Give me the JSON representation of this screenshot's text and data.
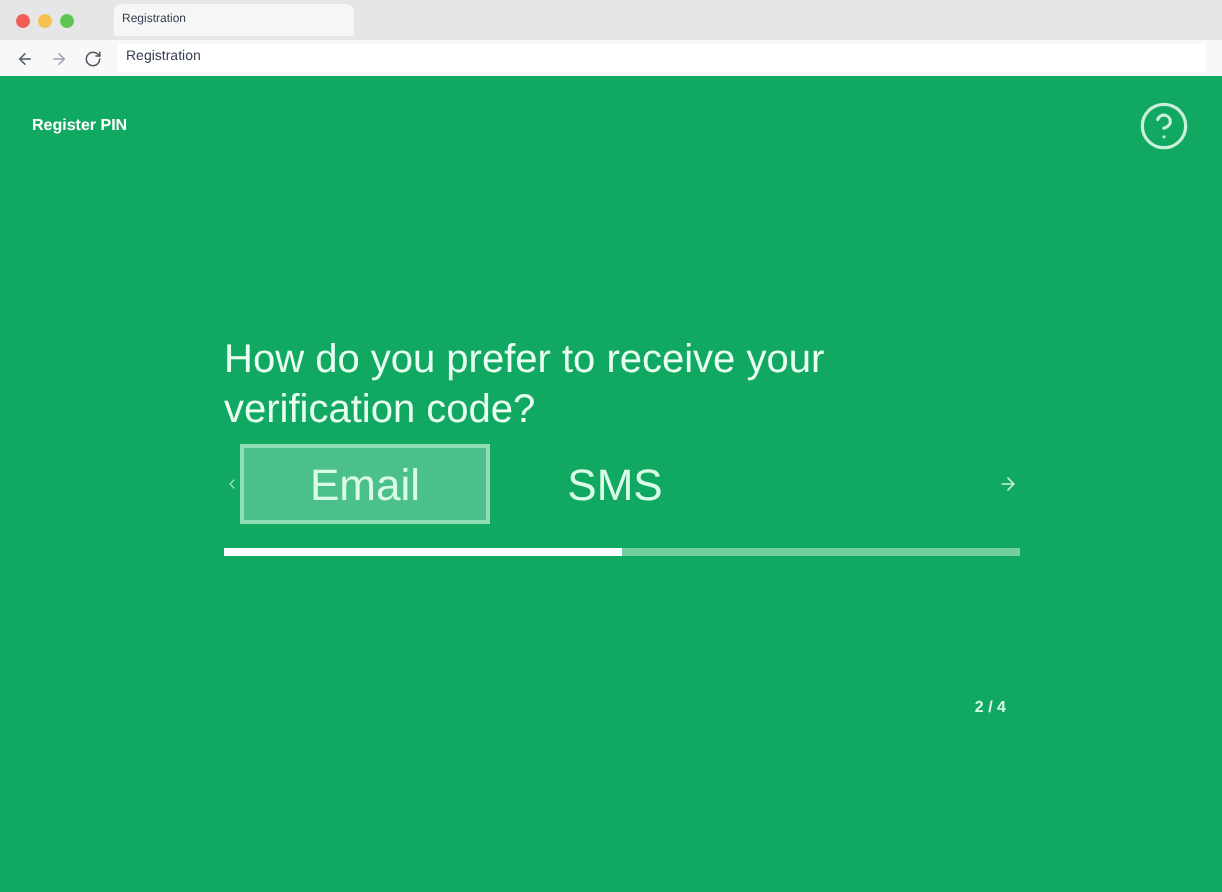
{
  "browser": {
    "tab_title": "Registration",
    "address": "Registration"
  },
  "header": {
    "title": "Register PIN"
  },
  "question": "How do you prefer to receive your verification code?",
  "options": [
    {
      "label": "Email",
      "selected": true
    },
    {
      "label": "SMS",
      "selected": false
    }
  ],
  "progress": {
    "level": 0.5
  },
  "step": "2 / 4"
}
